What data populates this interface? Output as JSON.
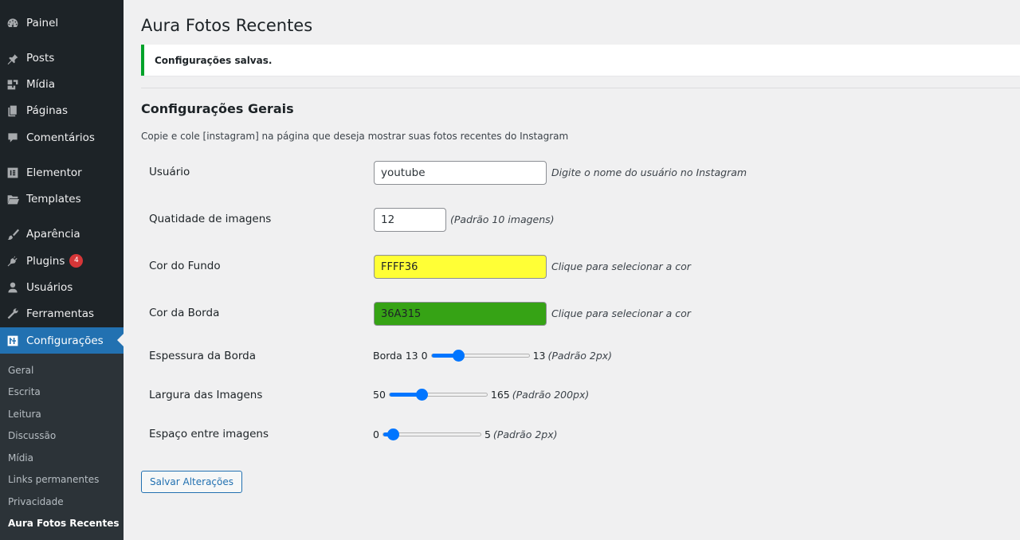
{
  "sidebar": {
    "items": [
      {
        "label": "Painel",
        "icon": "dashboard-icon"
      },
      {
        "label": "Posts",
        "icon": "pin-icon"
      },
      {
        "label": "Mídia",
        "icon": "media-icon"
      },
      {
        "label": "Páginas",
        "icon": "pages-icon"
      },
      {
        "label": "Comentários",
        "icon": "comments-icon"
      },
      {
        "label": "Elementor",
        "icon": "elementor-icon"
      },
      {
        "label": "Templates",
        "icon": "folder-icon"
      },
      {
        "label": "Aparência",
        "icon": "paintbrush-icon"
      },
      {
        "label": "Plugins",
        "icon": "plugin-icon",
        "badge": "4"
      },
      {
        "label": "Usuários",
        "icon": "users-icon"
      },
      {
        "label": "Ferramentas",
        "icon": "wrench-icon"
      },
      {
        "label": "Configurações",
        "icon": "settings-icon"
      }
    ],
    "submenu": [
      "Geral",
      "Escrita",
      "Leitura",
      "Discussão",
      "Mídia",
      "Links permanentes",
      "Privacidade",
      "Aura Fotos Recentes"
    ]
  },
  "page": {
    "title": "Aura Fotos Recentes",
    "notice": "Configurações salvas.",
    "section_title": "Configurações Gerais",
    "section_desc": "Copie e cole [instagram] na página que deseja mostrar suas fotos recentes do Instagram"
  },
  "form": {
    "usuario": {
      "label": "Usuário",
      "value": "youtube",
      "desc": "Digite o nome do usuário no Instagram"
    },
    "quantidade": {
      "label": "Quatidade de imagens",
      "value": "12",
      "desc": "(Padrão 10 imagens)"
    },
    "cor_fundo": {
      "label": "Cor do Fundo",
      "value": "FFFF36",
      "color": "#FFFF36",
      "desc": "Clique para selecionar a cor"
    },
    "cor_borda": {
      "label": "Cor da Borda",
      "value": "36A315",
      "color": "#36A315",
      "desc": "Clique para selecionar a cor"
    },
    "espessura": {
      "label": "Espessura da Borda",
      "prefix": "Borda 13",
      "min": "0",
      "max": "13",
      "desc": "(Padrão 2px)",
      "fraction": 0.27
    },
    "largura": {
      "label": "Largura das Imagens",
      "min": "50",
      "max": "165",
      "desc": "(Padrão 200px)",
      "fraction": 0.33
    },
    "espaco": {
      "label": "Espaço entre imagens",
      "min": "0",
      "max": "5",
      "desc": "(Padrão 2px)",
      "fraction": 0.1
    }
  },
  "buttons": {
    "save": "Salvar Alterações"
  },
  "colors": {
    "sidebar_bg": "#1d2327",
    "accent": "#2271b1",
    "success": "#00a32a",
    "badge": "#d63638"
  }
}
